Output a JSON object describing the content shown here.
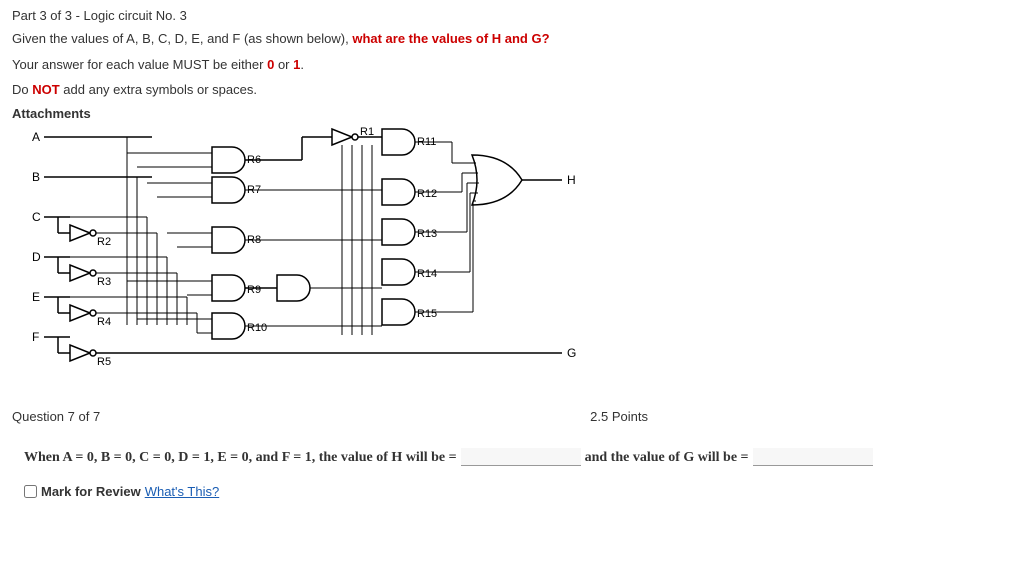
{
  "part_title": "Part 3 of 3 - Logic circuit No. 3",
  "line1_prefix": "Given the values of A, B, C, D, E, and F (as shown below), ",
  "line1_highlight": "what are the values of H and G?",
  "line2_prefix": "Your answer for each value MUST be either ",
  "line2_zero": "0",
  "line2_mid": " or ",
  "line2_one": "1",
  "line2_suffix": ".",
  "line3_prefix": "Do ",
  "line3_not": "NOT",
  "line3_suffix": " add any extra symbols or spaces.",
  "attachments_label": "Attachments",
  "question_num": "Question 7 of 7",
  "points": "2.5 Points",
  "q_text_1": "When A = 0, B = 0, C = 0, D = 1, E = 0, and F = 1, the value of H will be =",
  "q_text_2": "and the value of G will be =",
  "mark_label": "Mark for Review",
  "whats_this": " What's This?",
  "io": {
    "A": "A",
    "B": "B",
    "C": "C",
    "D": "D",
    "E": "E",
    "F": "F",
    "G": "G",
    "H": "H"
  },
  "gates": {
    "R1": "R1",
    "R2": "R2",
    "R3": "R3",
    "R4": "R4",
    "R5": "R5",
    "R6": "R6",
    "R7": "R7",
    "R8": "R8",
    "R9": "R9",
    "R10": "R10",
    "R11": "R11",
    "R12": "R12",
    "R13": "R13",
    "R14": "R14",
    "R15": "R15"
  }
}
